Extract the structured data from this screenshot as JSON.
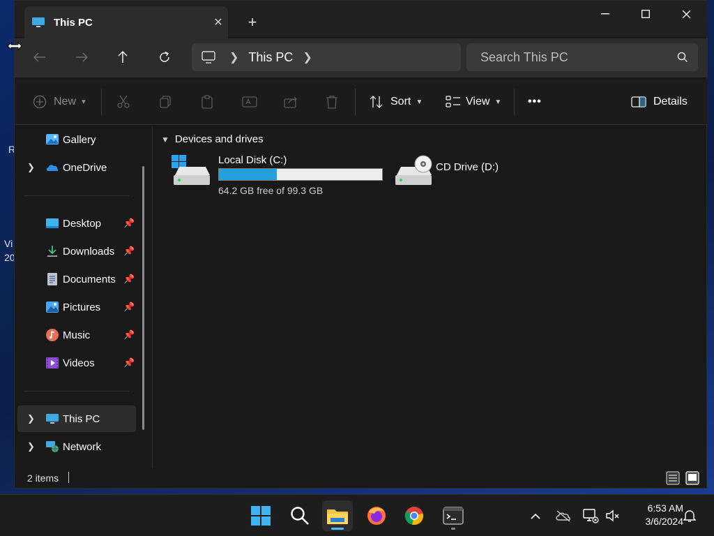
{
  "desktop": {
    "fragments": [
      "R",
      "Vi",
      "20"
    ]
  },
  "window": {
    "tab_title": "This PC",
    "new_tab_label": "+"
  },
  "address": {
    "breadcrumb": "This PC",
    "search_placeholder": "Search This PC"
  },
  "command_bar": {
    "new_label": "New",
    "sort_label": "Sort",
    "view_label": "View",
    "more_label": "•••",
    "details_label": "Details"
  },
  "nav": {
    "items": [
      {
        "label": "Gallery",
        "icon": "gallery-icon",
        "expand": false,
        "pin": false
      },
      {
        "label": "OneDrive",
        "icon": "onedrive-icon",
        "expand": true,
        "pin": false
      },
      {
        "label": "Desktop",
        "icon": "desktop-folder-icon",
        "expand": false,
        "pin": true
      },
      {
        "label": "Downloads",
        "icon": "downloads-icon",
        "expand": false,
        "pin": true
      },
      {
        "label": "Documents",
        "icon": "documents-icon",
        "expand": false,
        "pin": true
      },
      {
        "label": "Pictures",
        "icon": "pictures-icon",
        "expand": false,
        "pin": true
      },
      {
        "label": "Music",
        "icon": "music-icon",
        "expand": false,
        "pin": true
      },
      {
        "label": "Videos",
        "icon": "videos-icon",
        "expand": false,
        "pin": true
      },
      {
        "label": "This PC",
        "icon": "this-pc-icon",
        "expand": true,
        "pin": false,
        "selected": true
      },
      {
        "label": "Network",
        "icon": "network-icon",
        "expand": true,
        "pin": false
      }
    ]
  },
  "content": {
    "group_label": "Devices and drives",
    "drives": [
      {
        "name": "Local Disk (C:)",
        "free_text": "64.2 GB free of 99.3 GB",
        "used_fraction": 0.353,
        "icon": "local-disk-icon"
      },
      {
        "name": "CD Drive (D:)",
        "icon": "cd-drive-icon"
      }
    ]
  },
  "status": {
    "items_count": "2 items"
  },
  "taskbar": {
    "apps": [
      "windows-start-icon",
      "search-icon",
      "file-explorer-icon",
      "firefox-icon",
      "chrome-icon",
      "terminal-icon"
    ],
    "time": "6:53 AM",
    "date": "3/6/2024"
  },
  "colors": {
    "accent": "#26a0da",
    "background": "#191919"
  }
}
